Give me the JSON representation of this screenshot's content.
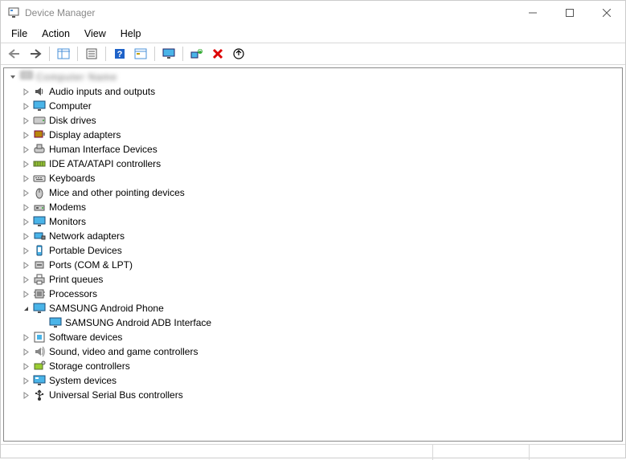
{
  "window": {
    "title": "Device Manager"
  },
  "menu": {
    "items": [
      "File",
      "Action",
      "View",
      "Help"
    ]
  },
  "toolbar": {
    "back": "Back",
    "forward": "Forward",
    "show_hide": "Show/Hide Console Tree",
    "properties": "Properties",
    "help": "Help",
    "action_btn": "Action",
    "monitor": "View",
    "scan": "Scan for hardware changes",
    "remove": "Uninstall device",
    "update": "Update driver"
  },
  "tree": {
    "root": "Computer Name",
    "categories": [
      {
        "label": "Audio inputs and outputs",
        "icon": "speaker"
      },
      {
        "label": "Computer",
        "icon": "monitor-blue"
      },
      {
        "label": "Disk drives",
        "icon": "disk"
      },
      {
        "label": "Display adapters",
        "icon": "display-adapter"
      },
      {
        "label": "Human Interface Devices",
        "icon": "hid"
      },
      {
        "label": "IDE ATA/ATAPI controllers",
        "icon": "ide"
      },
      {
        "label": "Keyboards",
        "icon": "keyboard"
      },
      {
        "label": "Mice and other pointing devices",
        "icon": "mouse"
      },
      {
        "label": "Modems",
        "icon": "modem"
      },
      {
        "label": "Monitors",
        "icon": "monitor-blue"
      },
      {
        "label": "Network adapters",
        "icon": "network"
      },
      {
        "label": "Portable Devices",
        "icon": "portable"
      },
      {
        "label": "Ports (COM & LPT)",
        "icon": "port"
      },
      {
        "label": "Print queues",
        "icon": "printer"
      },
      {
        "label": "Processors",
        "icon": "cpu"
      },
      {
        "label": "SAMSUNG Android Phone",
        "icon": "monitor-blue",
        "expanded": true,
        "children": [
          {
            "label": "SAMSUNG Android ADB Interface",
            "icon": "monitor-blue"
          }
        ]
      },
      {
        "label": "Software devices",
        "icon": "software"
      },
      {
        "label": "Sound, video and game controllers",
        "icon": "sound"
      },
      {
        "label": "Storage controllers",
        "icon": "storage"
      },
      {
        "label": "System devices",
        "icon": "system"
      },
      {
        "label": "Universal Serial Bus controllers",
        "icon": "usb"
      }
    ]
  }
}
